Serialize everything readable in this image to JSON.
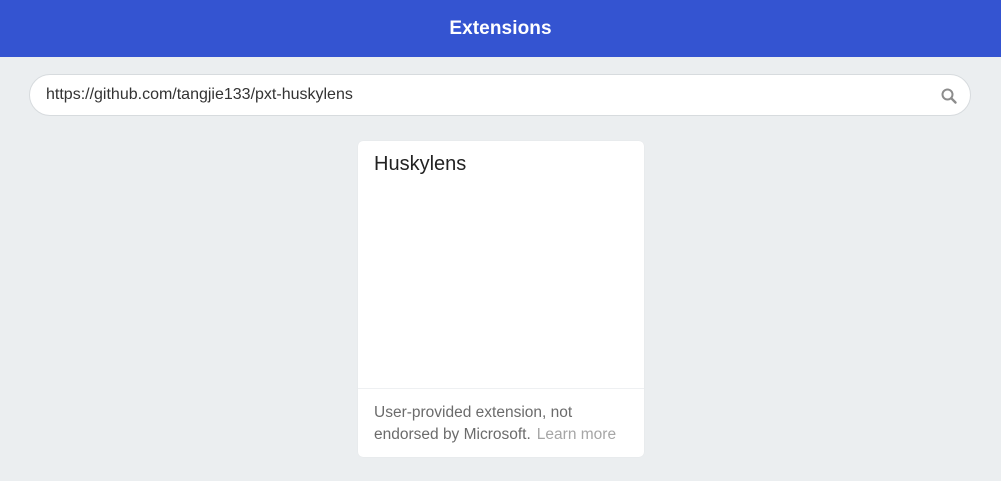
{
  "header": {
    "title": "Extensions"
  },
  "search": {
    "value": "https://github.com/tangjie133/pxt-huskylens",
    "icon": "search-icon"
  },
  "results": [
    {
      "title": "Huskylens",
      "disclaimer": "User-provided extension, not endorsed by Microsoft.",
      "learn_more": "Learn more"
    }
  ],
  "colors": {
    "header_bg": "#3454d1",
    "page_bg": "#ebeef0"
  }
}
